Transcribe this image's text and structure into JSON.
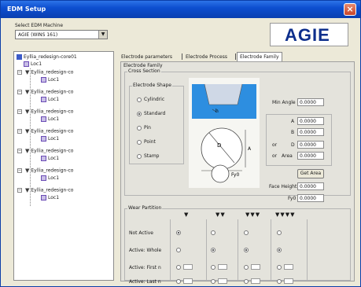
{
  "window": {
    "title": "EDM Setup",
    "close_glyph": "×"
  },
  "machine": {
    "label": "Select EDM Machine",
    "value": "AGIE (WINS 161)",
    "arrow": "▼"
  },
  "logo": {
    "text": "AGIE"
  },
  "tree": {
    "root": "Eyllia_redesign-core01",
    "loc_top": "Loc1",
    "items": [
      {
        "label": "Eyllia_redesign-co",
        "loc": "Loc1"
      },
      {
        "label": "Eyllia_redesign-co",
        "loc": "Loc1"
      },
      {
        "label": "Eyllia_redesign-co",
        "loc": "Loc1"
      },
      {
        "label": "Eyllia_redesign-co",
        "loc": "Loc1"
      },
      {
        "label": "Eyllia_redesign-co",
        "loc": "Loc1"
      },
      {
        "label": "Eyllia_redesign-co",
        "loc": "Loc1"
      },
      {
        "label": "Eyllia_redesign-co",
        "loc": "Loc1"
      }
    ]
  },
  "tabs": [
    "Electrode parameters",
    "Electrode Process",
    "Electrode Family"
  ],
  "family": {
    "group_label": "Electrode Family",
    "cross_section_label": "Cross Section",
    "shape_label": "Electrode Shape",
    "shapes": [
      "Cylindric",
      "Standard",
      "Pin",
      "Point",
      "Stamp"
    ],
    "selected_shape": "Standard",
    "min_angle_label": "Min Angle",
    "min_angle_value": "0.0000",
    "rows": [
      {
        "label": "A",
        "value": "0.0000"
      },
      {
        "label": "B",
        "value": "0.0000"
      },
      {
        "label": "D",
        "value": "0.0000"
      },
      {
        "label": "Area",
        "value": "0.0000"
      }
    ],
    "row_prefix_d": "or",
    "row_prefix_area": "or",
    "get_area_label": "Get Area",
    "face_height_label": "Face Height",
    "face_height_value": "0.0000",
    "fy0_label": "Fy0",
    "fy0_value": "0.0000",
    "diagram": {
      "label_h": "h",
      "label_d": "D",
      "label_a": "A",
      "label_b": "B",
      "label_fy": "Fy0"
    }
  },
  "wire": {
    "group_label": "Wear Partition",
    "columns": [
      "▼",
      "▼▼",
      "▼▼▼",
      "▼▼▼▼"
    ],
    "rows": [
      "Not Active",
      "Active: Whole",
      "Active: First n",
      "Active: Last n"
    ]
  }
}
